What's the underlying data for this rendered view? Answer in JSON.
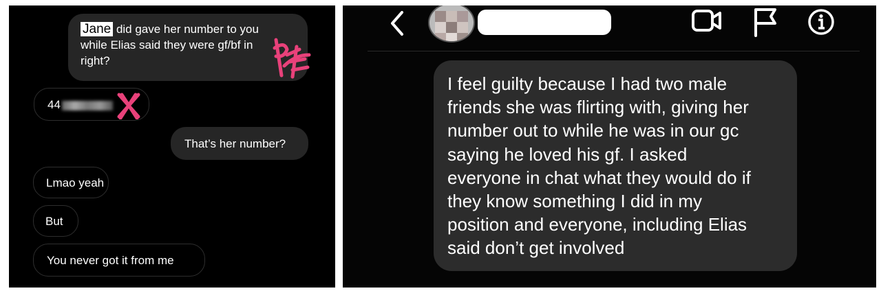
{
  "left_chat": {
    "messages": [
      {
        "side": "sent",
        "name": "Jane",
        "text_line1": "did gave her number to you",
        "text_line2": "while Elias said they were gf/bf in",
        "text_line3": "right?"
      },
      {
        "side": "received",
        "number_prefix": "44"
      },
      {
        "side": "sent",
        "text": "That’s her number?"
      },
      {
        "side": "received",
        "text": "Lmao yeah"
      },
      {
        "side": "received",
        "text": "But"
      },
      {
        "side": "received",
        "text": "You never got it from me"
      }
    ]
  },
  "right_chat": {
    "header": {
      "icons": [
        "back-chevron-icon",
        "video-call-icon",
        "flag-icon",
        "info-icon"
      ]
    },
    "message_lines": [
      "I feel guilty because I had two male",
      "friends she was flirting with, giving her",
      "number out to while he was in our gc",
      "saying he loved his gf. I asked",
      "everyone in chat what they would do if",
      "they know something I did in my",
      "position and everyone, including Elias",
      "said don’t get involved"
    ]
  },
  "colors": {
    "bubble_sent": "#262626",
    "bubble_right": "#2c2c2c",
    "scribble": "#e8417a"
  }
}
